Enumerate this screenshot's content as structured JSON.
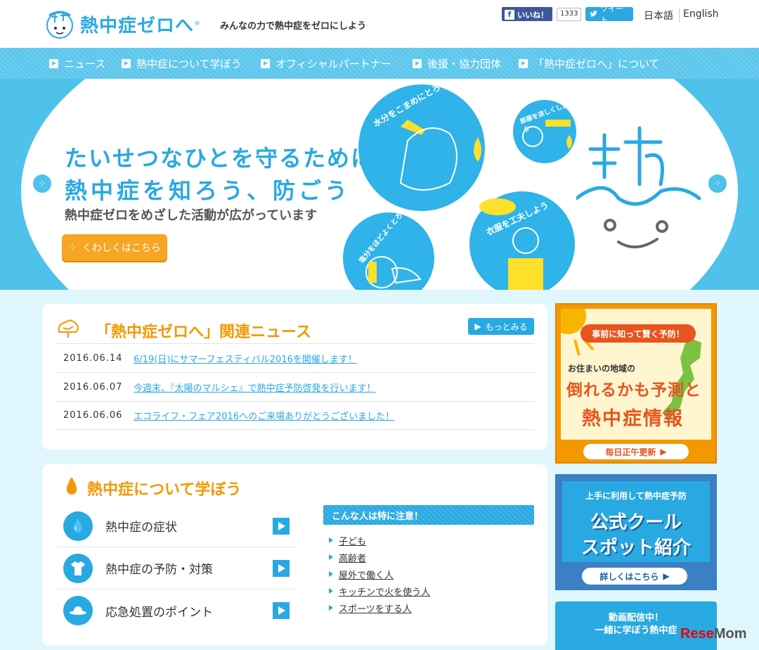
{
  "header": {
    "logo_text": "熱中症ゼロへ",
    "logo_reg": "®",
    "tagline": "みんなの力で熱中症をゼロにしよう",
    "fb_like": "いいね！",
    "fb_count": "1333",
    "tweet": "ツイート",
    "lang_ja": "日本語",
    "lang_en": "English"
  },
  "nav": {
    "items": [
      {
        "label": "ニュース"
      },
      {
        "label": "熱中症について学ぼう"
      },
      {
        "label": "オフィシャルパートナー"
      },
      {
        "label": "後援・協力団体"
      },
      {
        "label": "「熱中症ゼロへ」について"
      }
    ]
  },
  "hero": {
    "line1": "たいせつなひとを守るために",
    "line2": "熱中症を知ろう、防ごう",
    "sub": "熱中症ゼロをめざした活動が広がっています",
    "cta": "くわしくはこちら",
    "circle1": "水分をこまめにとろう",
    "circle2": "部屋を涼しくしよう",
    "circle3": "塩分をほどよくとろう",
    "circle4": "衣服を工夫しよう",
    "prev_icon": "left-arrow-icon",
    "next_icon": "right-arrow-icon"
  },
  "news": {
    "title": "「熱中症ゼロへ」関連ニュース",
    "more": "もっとみる",
    "items": [
      {
        "date": "2016.06.14",
        "text": "6/19(日)にサマーフェスティバル2016を開催します！"
      },
      {
        "date": "2016.06.07",
        "text": "今週末、『太陽のマルシェ』で熱中症予防啓発を行います！"
      },
      {
        "date": "2016.06.06",
        "text": "エコライフ・フェア2016へのご来場ありがとうございました！"
      }
    ]
  },
  "learn": {
    "title": "熱中症について学ぼう",
    "items": [
      {
        "label": "熱中症の症状",
        "icon": "drops-icon"
      },
      {
        "label": "熱中症の予防・対策",
        "icon": "tshirt-icon"
      },
      {
        "label": "応急処置のポイント",
        "icon": "hat-icon"
      }
    ],
    "caution_head": "こんな人は特に注意！",
    "caution_items": [
      "子ども",
      "高齢者",
      "屋外で働く人",
      "キッチンで火を使う人",
      "スポーツをする人"
    ]
  },
  "sidebar": {
    "banner1": {
      "tag": "事前に知って賢く予防！",
      "sub": "お住まいの地域の",
      "big1": "倒れるかも予測と",
      "big2": "熱中症情報",
      "foot": "毎日正午更新"
    },
    "banner2": {
      "sub": "上手に利用して熱中症予防",
      "big1": "公式クール",
      "big2": "スポット紹介",
      "foot": "詳しくはこちら"
    },
    "banner3": {
      "line1": "動画配信中！",
      "line2": "一緒に学ぼう熱中症"
    }
  },
  "watermark": {
    "prefix": "Rese",
    "suffix": "Mom"
  },
  "colors": {
    "brand_blue": "#29a9e1",
    "accent_orange": "#f39800",
    "nav_bg": "#5bc6ec"
  }
}
